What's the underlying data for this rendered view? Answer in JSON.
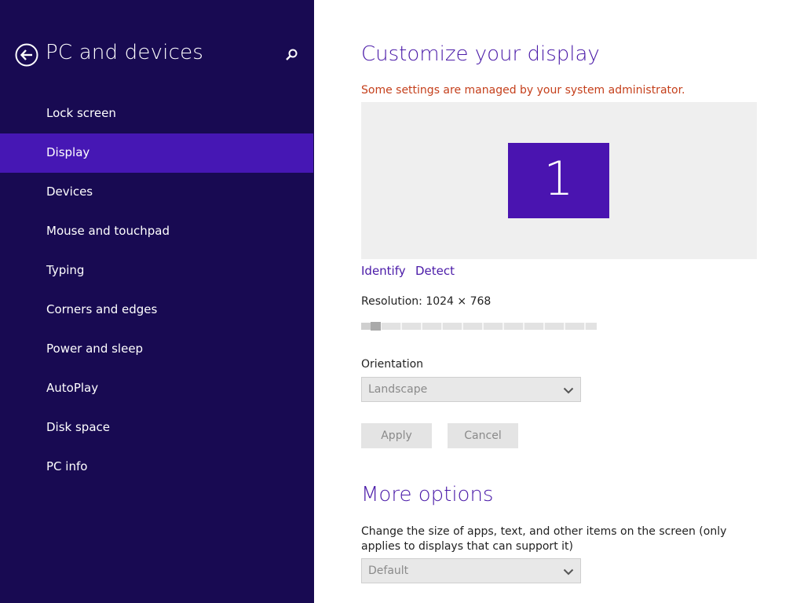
{
  "sidebar": {
    "title": "PC and devices",
    "items": [
      {
        "label": "Lock screen"
      },
      {
        "label": "Display"
      },
      {
        "label": "Devices"
      },
      {
        "label": "Mouse and touchpad"
      },
      {
        "label": "Typing"
      },
      {
        "label": "Corners and edges"
      },
      {
        "label": "Power and sleep"
      },
      {
        "label": "AutoPlay"
      },
      {
        "label": "Disk space"
      },
      {
        "label": "PC info"
      }
    ],
    "selected_item": "Display",
    "back_icon": "back-arrow-icon",
    "search_icon": "search-icon"
  },
  "main": {
    "title": "Customize your display",
    "admin_notice": "Some settings are managed by your system administrator.",
    "monitor_number": "1",
    "identify_link": "Identify",
    "detect_link": "Detect",
    "resolution_label": "Resolution: 1024 × 768",
    "resolution_slider_position": 0.05,
    "orientation_label": "Orientation",
    "orientation_value": "Landscape",
    "apply_label": "Apply",
    "cancel_label": "Cancel",
    "more_options_title": "More options",
    "size_description": "Change the size of apps, text, and other items on the screen (only applies to displays that can support it)",
    "size_value": "Default"
  },
  "colors": {
    "sidebar_bg": "#180a52",
    "selected_bg": "#4617b4",
    "accent": "#4a1aa8",
    "warning": "#c5401c",
    "monitor_tile": "#4a14b0"
  }
}
